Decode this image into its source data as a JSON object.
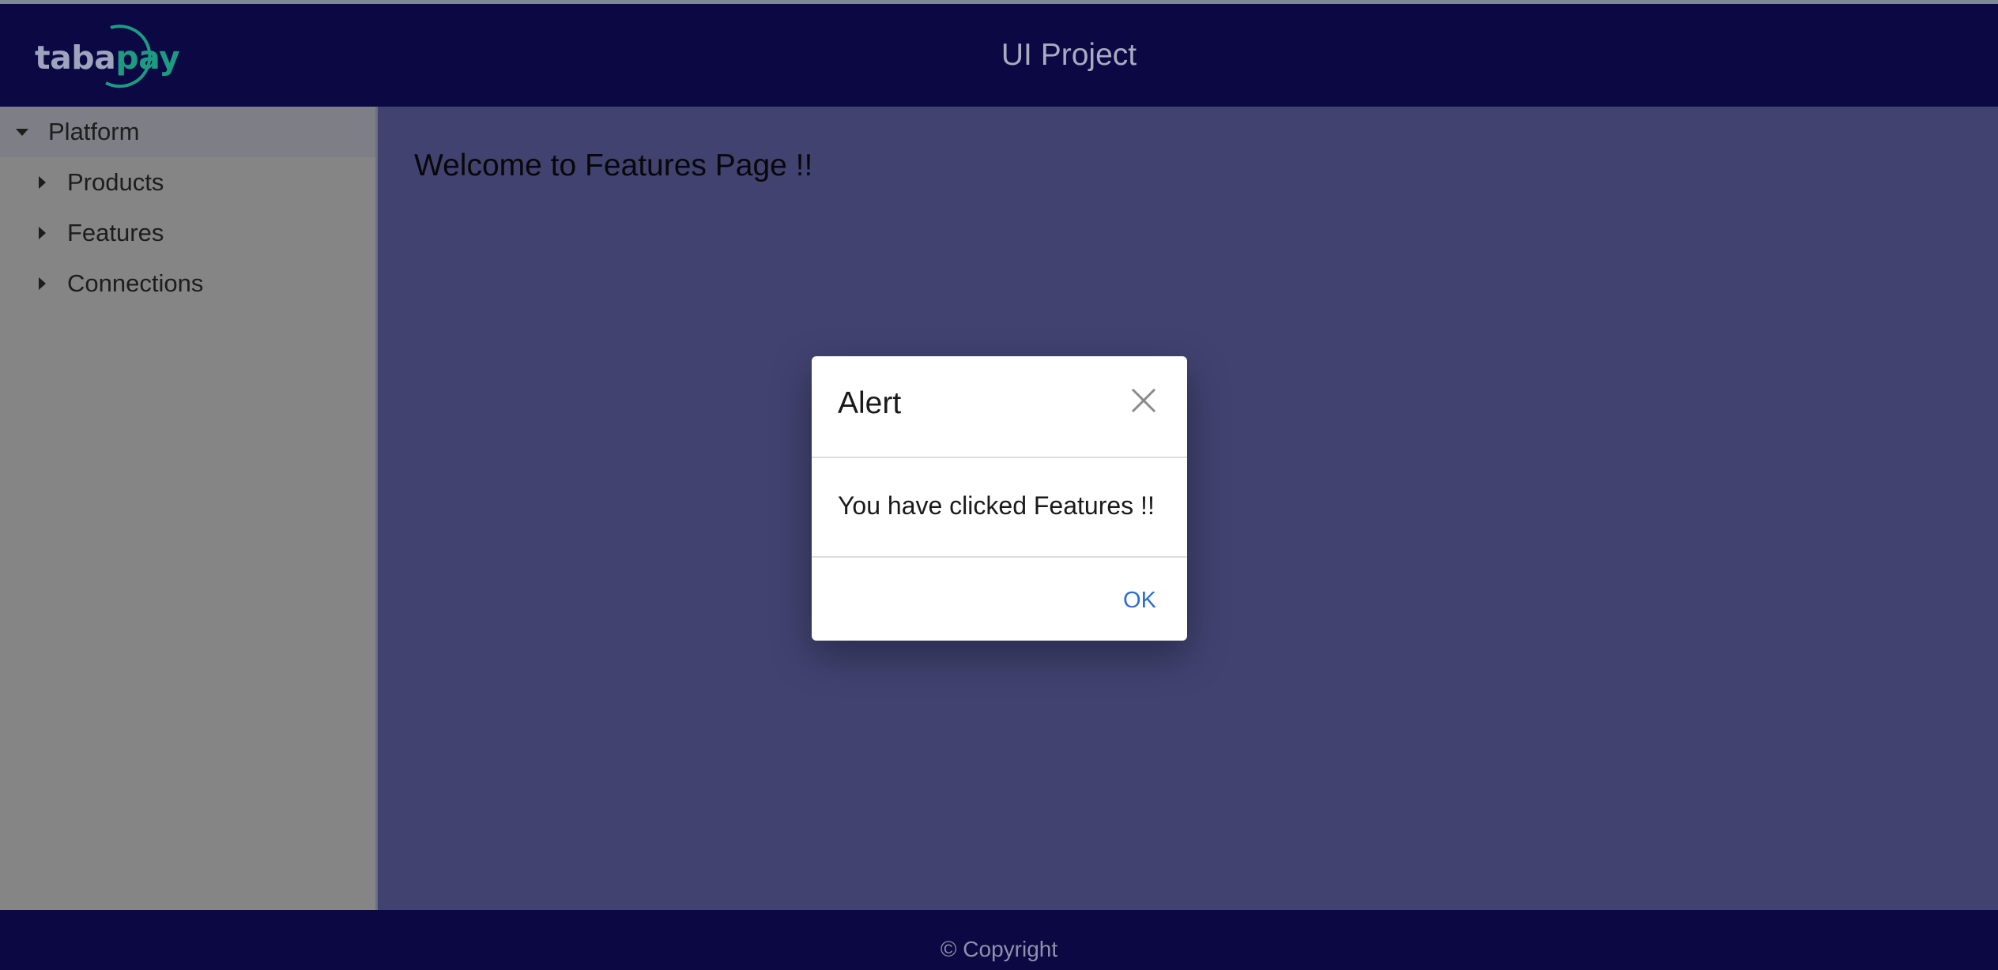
{
  "header": {
    "logo_text_a": "taba",
    "logo_text_b": "pay",
    "title": "UI Project"
  },
  "sidebar": {
    "items": [
      {
        "label": "Platform",
        "expanded": true,
        "selected": true
      },
      {
        "label": "Products",
        "expanded": false
      },
      {
        "label": "Features",
        "expanded": false
      },
      {
        "label": "Connections",
        "expanded": false
      }
    ]
  },
  "main": {
    "title": "Welcome to Features Page !!"
  },
  "dialog": {
    "title": "Alert",
    "message": "You have clicked Features !!",
    "ok_label": "OK",
    "close_icon": "close-icon"
  },
  "footer": {
    "copyright": "© Copyright"
  },
  "colors": {
    "header_bg": "#0c0844",
    "main_bg": "#414270",
    "sidebar_bg": "#858585",
    "logo_accent": "#1d9a82",
    "link_blue": "#2b6ed0"
  }
}
